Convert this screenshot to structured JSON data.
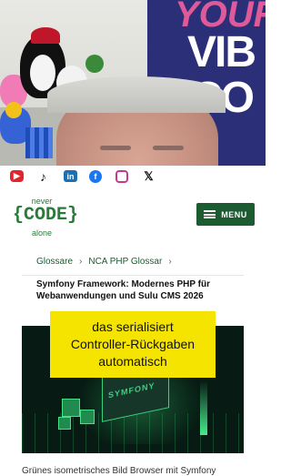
{
  "video": {
    "banner_text": [
      "YOUR",
      "VIB",
      "CO"
    ]
  },
  "social": {
    "items": [
      {
        "name": "youtube",
        "glyph": "▶",
        "color": "#e3242b"
      },
      {
        "name": "tiktok",
        "glyph": "♪",
        "color": "#111111"
      },
      {
        "name": "linkedin",
        "glyph": "in",
        "color": "#1a6fb5"
      },
      {
        "name": "facebook",
        "glyph": "f",
        "color": "#1877f2"
      },
      {
        "name": "instagram",
        "glyph": "",
        "color": "#c63a8a"
      },
      {
        "name": "x",
        "glyph": "𝕏",
        "color": "#111111"
      }
    ]
  },
  "header": {
    "logo": {
      "top": "never",
      "main": "{CODE}",
      "bottom": "alone"
    },
    "menu_label": "MENU",
    "accent_color": "#1c5b32"
  },
  "breadcrumb": {
    "items": [
      "Glossare",
      "NCA PHP Glossar"
    ]
  },
  "article": {
    "title": "Symfony Framework: Modernes PHP für Webanwendungen und Sulu CMS 2026",
    "hero_board_text": "SYMFONY",
    "caption": "Grünes isometrisches Bild Browser mit Symfony"
  },
  "subtitle": {
    "lines": [
      "das serialisiert",
      "Controller-Rückgaben",
      "automatisch"
    ],
    "background": "#f5e400"
  }
}
